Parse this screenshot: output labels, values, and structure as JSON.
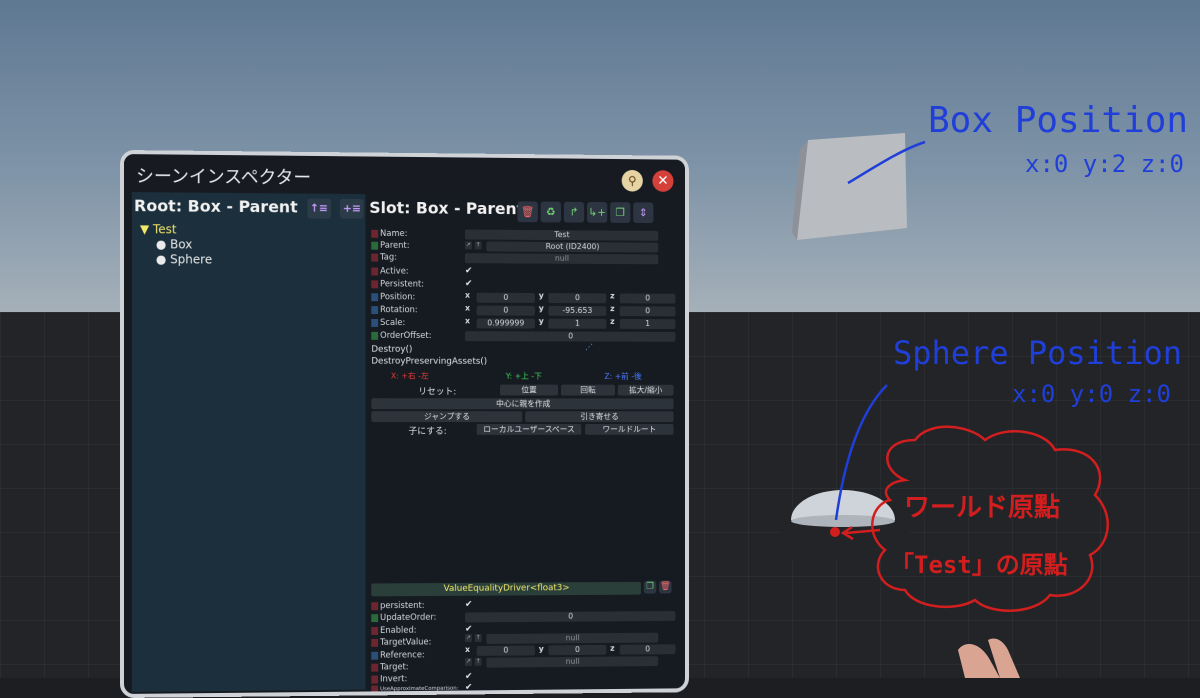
{
  "inspector": {
    "title": "シーンインスペクター",
    "root_header": "Root: Box - Parent",
    "slot_header": "Slot: Box - Parent",
    "tree": {
      "root": "Test",
      "children": [
        "Box",
        "Sphere"
      ]
    },
    "fields": {
      "name_label": "Name:",
      "name_value": "Test",
      "parent_label": "Parent:",
      "parent_value": "Root (ID2400)",
      "tag_label": "Tag:",
      "tag_value": "null",
      "active_label": "Active:",
      "persistent_label": "Persistent:",
      "position_label": "Position:",
      "position": {
        "x": "0",
        "y": "0",
        "z": "0"
      },
      "rotation_label": "Rotation:",
      "rotation": {
        "x": "0",
        "y": "-95.653",
        "z": "0"
      },
      "scale_label": "Scale:",
      "scale": {
        "x": "0.999999",
        "y": "1",
        "z": "1"
      },
      "orderoffset_label": "OrderOffset:",
      "orderoffset_value": "0"
    },
    "actions": {
      "destroy": "Destroy()",
      "destroy_preserving": "DestroyPreservingAssets()",
      "axis_x": "X: +右 -左",
      "axis_y": "Y: +上 -下",
      "axis_z": "Z: +前 -後",
      "reset_label": "リセット:",
      "reset_position": "位置",
      "reset_rotation": "回転",
      "reset_scale": "拡大/縮小",
      "create_parent": "中心に親を作成",
      "jump": "ジャンプする",
      "bring": "引き寄せる",
      "child_label": "子にする:",
      "local_user_space": "ローカルユーザースペース",
      "world_root": "ワールドルート"
    },
    "component": {
      "name": "ValueEqualityDriver<float3>",
      "persistent_label": "persistent:",
      "updateorder_label": "UpdateOrder:",
      "updateorder_value": "0",
      "enabled_label": "Enabled:",
      "targetvalue_label": "TargetValue:",
      "targetvalue_value": "null",
      "reference_label": "Reference:",
      "reference": {
        "x": "0",
        "y": "0",
        "z": "0"
      },
      "target_label": "Target:",
      "target_value": "null",
      "invert_label": "Invert:",
      "useapprox_label": "UseApproximateComparison:"
    }
  },
  "annotations": {
    "box_title": "Box Position",
    "box_coords": "x:0 y:2 z:0",
    "sphere_title": "Sphere Position",
    "sphere_coords": "x:0 y:0 z:0",
    "world_origin": "ワールド原點",
    "test_origin": "「Test」の原點"
  },
  "colors": {
    "annotation_blue": "#1f3fd8",
    "annotation_red": "#d21e1e",
    "highlight_yellow": "#f2e86a"
  }
}
